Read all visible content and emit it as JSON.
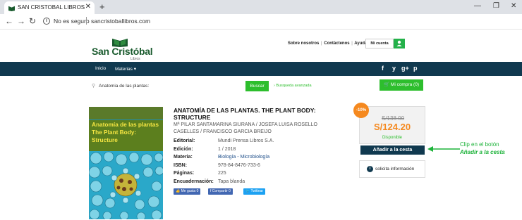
{
  "browser": {
    "tab_title": "SAN CRISTOBAL LIBROS",
    "new_tab": "+",
    "tab_close": "✕",
    "security_label": "No es seguro",
    "url": "sancristoballibros.com",
    "minimize": "—",
    "maximize": "❐",
    "close": "✕"
  },
  "header": {
    "logo_name": "San Cristóbal",
    "logo_sub": "Libros",
    "top_links": [
      "Sobre nosotros",
      "Contáctenos",
      "Ayuda"
    ],
    "account_label": "Mi cuenta"
  },
  "navbar": {
    "items": [
      "Inicio",
      "Materias ▾"
    ],
    "social": [
      "f",
      "y",
      "g+",
      "p"
    ]
  },
  "search": {
    "query": "Anatomia de las plantas:",
    "button_label": "Buscar",
    "advanced_label": "› Busqueda avanzada",
    "cart_label": "Mi compra (0)"
  },
  "book": {
    "cover_title": "Anatomía de las plantas",
    "cover_subtitle": "The Plant Body: Structure",
    "title": "ANATOMÍA DE LAS PLANTAS. THE PLANT BODY: STRUCTURE",
    "authors": "Mª PILAR SANTAMARINA SIURANA / JOSEFA LUISA ROSELLO CASELLES / FRANCISCO GARCIA BREIJO",
    "details": [
      {
        "label": "Editorial:",
        "value": "Mundi Prensa Libros S.A."
      },
      {
        "label": "Edición:",
        "value": "1 / 2018"
      },
      {
        "label": "Materia:",
        "value": "Biología - Microbiología"
      },
      {
        "label": "ISBN:",
        "value": "978-84-8476-733-6"
      },
      {
        "label": "Páginas:",
        "value": "225"
      },
      {
        "label": "Encuadernación:",
        "value": "Tapa blanda"
      }
    ],
    "share": {
      "like": "Me gusta 0",
      "fb_share": "Compartir 0",
      "twitter": "Twittear"
    }
  },
  "price": {
    "discount": "-10%",
    "old_price": "S/138.00",
    "new_price": "S/124.20",
    "availability": "Disponible",
    "add_to_cart": "Añadir a la cesta",
    "request_info": "solicita información"
  },
  "annotation": {
    "line1": "Clip en el botón",
    "line2": "Añadir a la cesta"
  },
  "colors": {
    "navbar": "#10394f",
    "accent_green": "#2dbe2d",
    "price_orange": "#f5891f",
    "logo_green": "#1a5b2e"
  }
}
